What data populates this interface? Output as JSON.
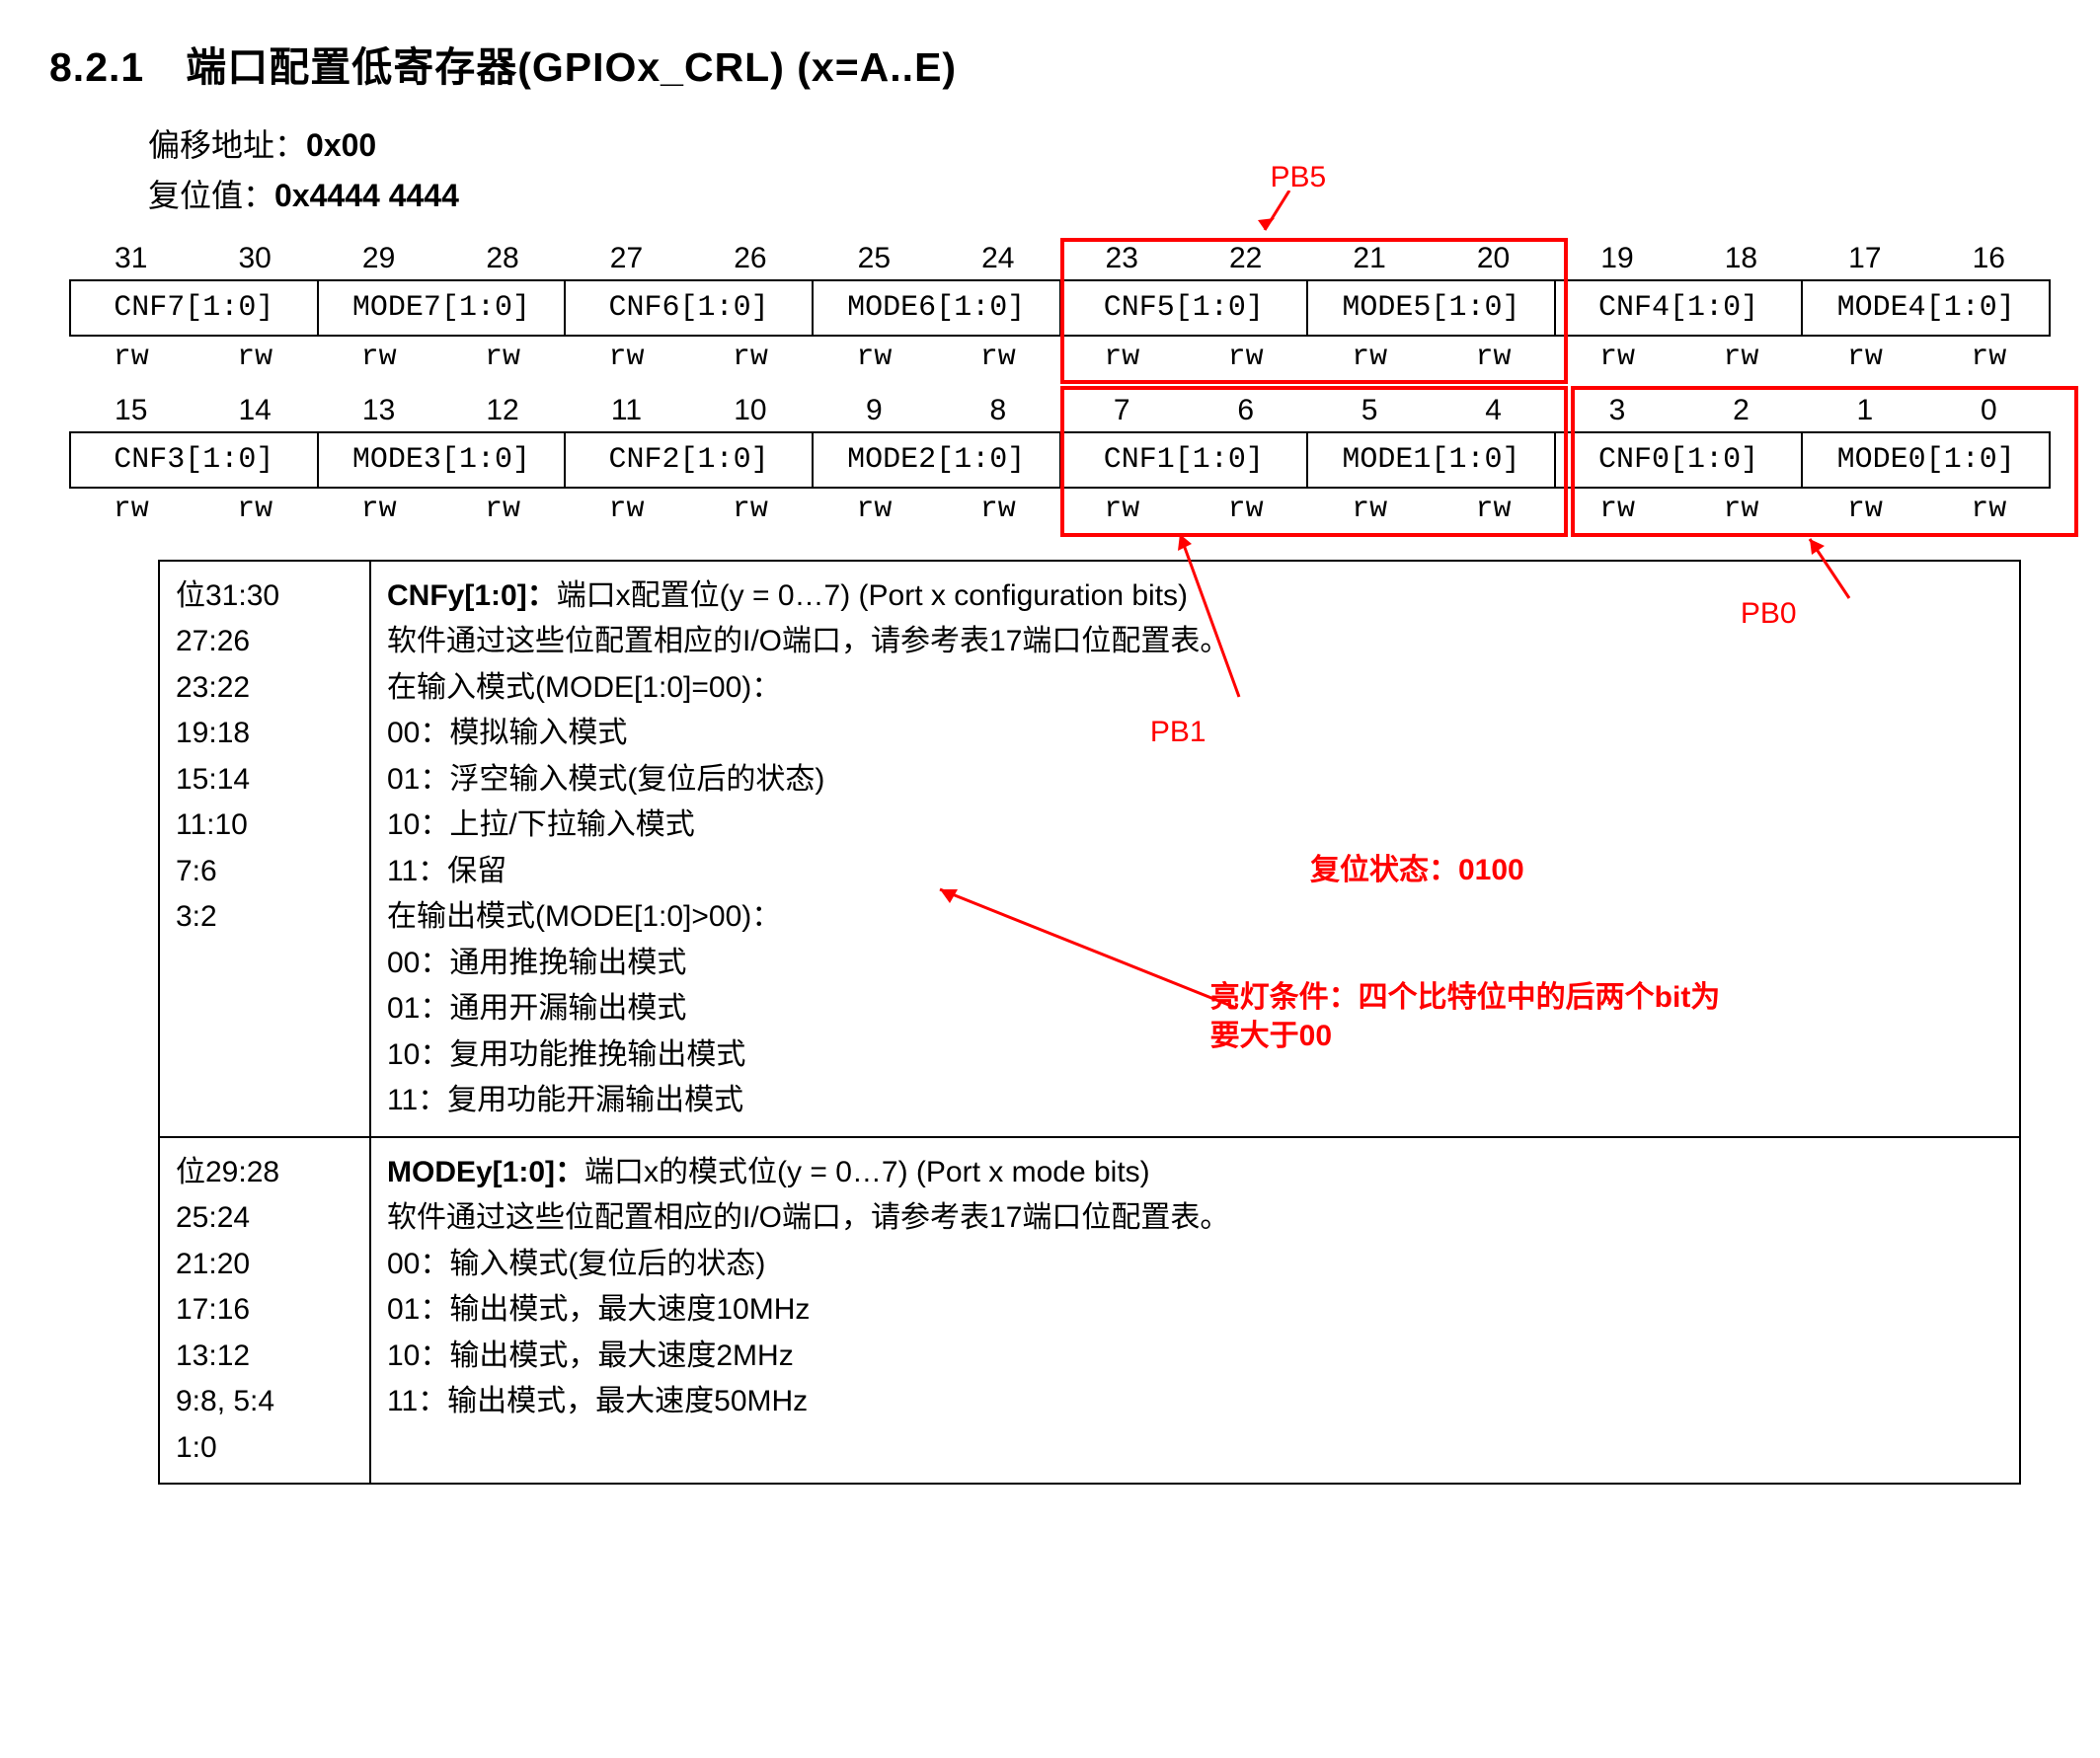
{
  "title": "8.2.1　端口配置低寄存器(GPIOx_CRL) (x=A..E)",
  "meta": {
    "offset_label": "偏移地址：",
    "offset_value": "0x00",
    "reset_label": "复位值：",
    "reset_value": "0x4444 4444"
  },
  "bits_high": [
    "31",
    "30",
    "29",
    "28",
    "27",
    "26",
    "25",
    "24",
    "23",
    "22",
    "21",
    "20",
    "19",
    "18",
    "17",
    "16"
  ],
  "row1": [
    "CNF7[1:0]",
    "MODE7[1:0]",
    "CNF6[1:0]",
    "MODE6[1:0]",
    "CNF5[1:0]",
    "MODE5[1:0]",
    "CNF4[1:0]",
    "MODE4[1:0]"
  ],
  "rw1": [
    "rw",
    "rw",
    "rw",
    "rw",
    "rw",
    "rw",
    "rw",
    "rw",
    "rw",
    "rw",
    "rw",
    "rw",
    "rw",
    "rw",
    "rw",
    "rw"
  ],
  "bits_low": [
    "15",
    "14",
    "13",
    "12",
    "11",
    "10",
    "9",
    "8",
    "7",
    "6",
    "5",
    "4",
    "3",
    "2",
    "1",
    "0"
  ],
  "row2": [
    "CNF3[1:0]",
    "MODE3[1:0]",
    "CNF2[1:0]",
    "MODE2[1:0]",
    "CNF1[1:0]",
    "MODE1[1:0]",
    "CNF0[1:0]",
    "MODE0[1:0]"
  ],
  "rw2": [
    "rw",
    "rw",
    "rw",
    "rw",
    "rw",
    "rw",
    "rw",
    "rw",
    "rw",
    "rw",
    "rw",
    "rw",
    "rw",
    "rw",
    "rw",
    "rw"
  ],
  "desc1_left": [
    "位31:30",
    "27:26",
    "23:22",
    "19:18",
    "15:14",
    "11:10",
    "7:6",
    "3:2"
  ],
  "desc1_lines": [
    {
      "bold": "CNFy[1:0]：",
      "rest": "端口x配置位(y = 0…7) (Port x configuration bits)"
    },
    {
      "rest": "软件通过这些位配置相应的I/O端口，请参考表17端口位配置表。"
    },
    {
      "rest": "在输入模式(MODE[1:0]=00)："
    },
    {
      "rest": "00：模拟输入模式"
    },
    {
      "rest": "01：浮空输入模式(复位后的状态)"
    },
    {
      "rest": "10：上拉/下拉输入模式"
    },
    {
      "rest": "11：保留"
    },
    {
      "rest": "在输出模式(MODE[1:0]>00)："
    },
    {
      "rest": "00：通用推挽输出模式"
    },
    {
      "rest": "01：通用开漏输出模式"
    },
    {
      "rest": "10：复用功能推挽输出模式"
    },
    {
      "rest": "11：复用功能开漏输出模式"
    }
  ],
  "desc2_left": [
    "位29:28",
    "25:24",
    "21:20",
    "17:16",
    "13:12",
    "9:8, 5:4",
    "1:0"
  ],
  "desc2_lines": [
    {
      "bold": "MODEy[1:0]：",
      "rest": "端口x的模式位(y = 0…7) (Port x mode bits)"
    },
    {
      "rest": "软件通过这些位配置相应的I/O端口，请参考表17端口位配置表。"
    },
    {
      "rest": "00：输入模式(复位后的状态)"
    },
    {
      "rest": "01：输出模式，最大速度10MHz"
    },
    {
      "rest": "10：输出模式，最大速度2MHz"
    },
    {
      "rest": "11：输出模式，最大速度50MHz"
    }
  ],
  "annotations": {
    "pb5": "PB5",
    "pb1": "PB1",
    "pb0": "PB0",
    "reset_state": "复位状态：0100",
    "led_cond": "亮灯条件：四个比特位中的后两个bit为要大于00"
  }
}
